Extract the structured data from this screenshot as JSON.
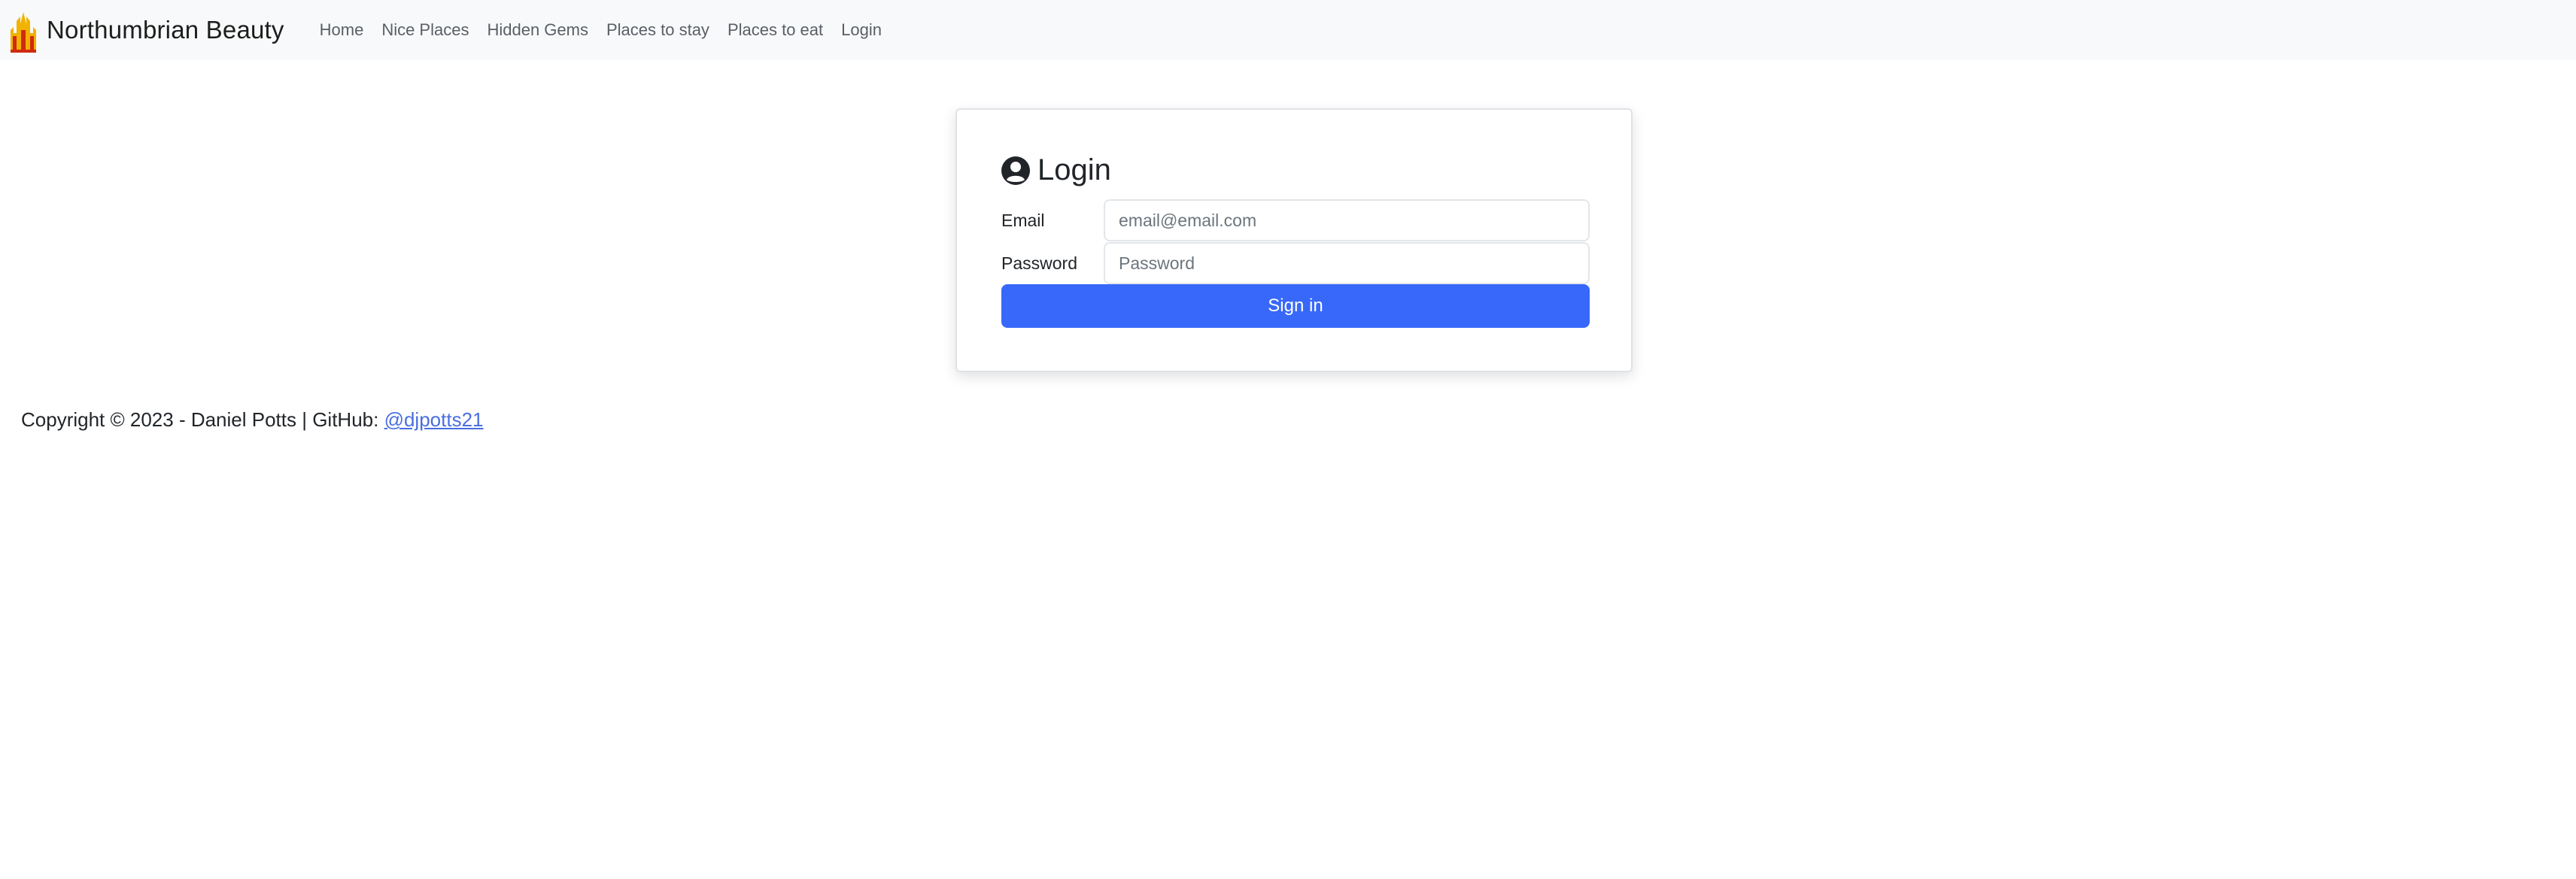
{
  "navbar": {
    "brand_title": "Northumbrian Beauty",
    "brand_icon": "castle-logo",
    "links": [
      {
        "label": "Home"
      },
      {
        "label": "Nice Places"
      },
      {
        "label": "Hidden Gems"
      },
      {
        "label": "Places to stay"
      },
      {
        "label": "Places to eat"
      },
      {
        "label": "Login"
      }
    ]
  },
  "login": {
    "title": "Login",
    "title_icon": "user-circle-icon",
    "email_label": "Email",
    "email_placeholder": "email@email.com",
    "email_value": "",
    "password_label": "Password",
    "password_placeholder": "Password",
    "password_value": "",
    "submit_label": "Sign in"
  },
  "footer": {
    "copyright": "Copyright © 2023 - Daniel Potts | GitHub: ",
    "github_handle": "@djpotts21"
  },
  "colors": {
    "navbar_bg": "#f8f9fa",
    "primary": "#3768f9",
    "link": "#4a6ee0"
  }
}
